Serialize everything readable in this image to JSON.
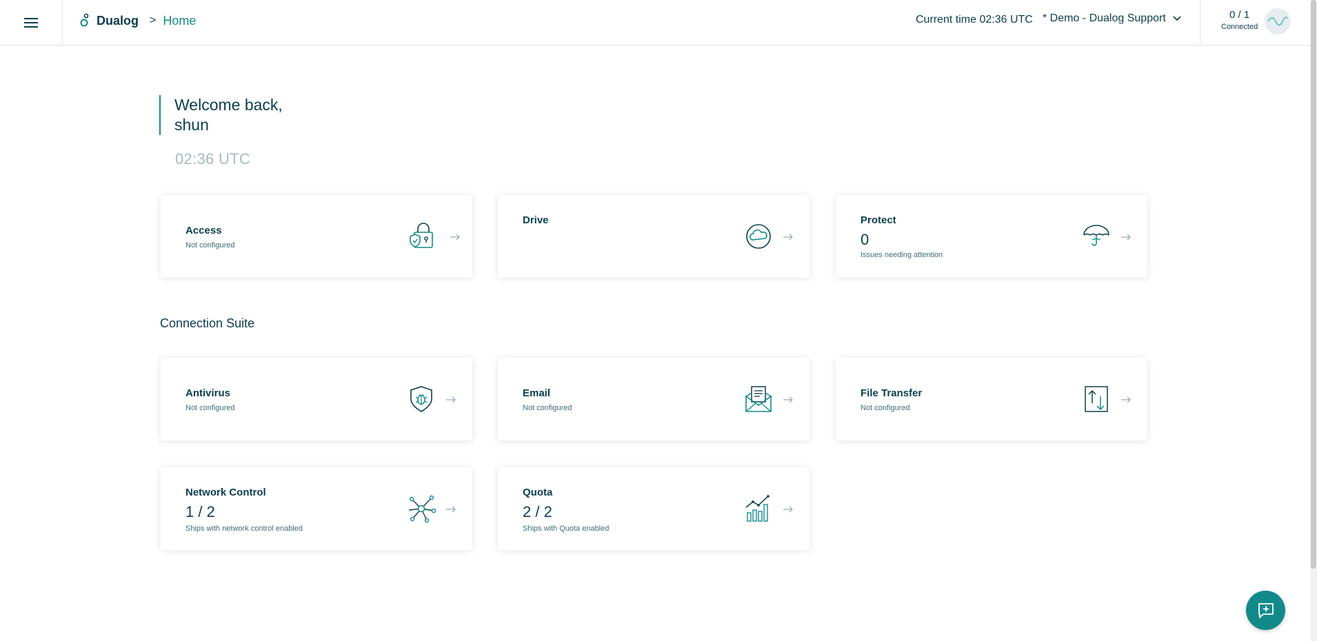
{
  "header": {
    "brand": "Dualog",
    "breadcrumb_sep": ">",
    "breadcrumb_current": "Home",
    "current_time": "Current time 02:36 UTC",
    "org_selected": "* Demo - Dualog Support",
    "connection_count": "0 / 1",
    "connection_label": "Connected"
  },
  "welcome": {
    "line1": "Welcome back,",
    "line2": "shun",
    "time": "02:36 UTC"
  },
  "top_cards": {
    "access": {
      "title": "Access",
      "sub": "Not configured",
      "icon": "lock-shield-icon"
    },
    "drive": {
      "title": "Drive",
      "icon": "cloud-icon"
    },
    "protect": {
      "title": "Protect",
      "value": "0",
      "sub": "Issues needing attention",
      "icon": "umbrella-icon"
    }
  },
  "section_title": "Connection Suite",
  "suite_cards": {
    "antivirus": {
      "title": "Antivirus",
      "sub": "Not configured",
      "icon": "bug-shield-icon"
    },
    "email": {
      "title": "Email",
      "sub": "Not configured",
      "icon": "envelope-icon"
    },
    "file_transfer": {
      "title": "File Transfer",
      "sub": "Not configured",
      "icon": "transfer-icon"
    },
    "network_control": {
      "title": "Network Control",
      "value": "1 / 2",
      "sub": "Ships with network control enabled",
      "icon": "network-nodes-icon"
    },
    "quota": {
      "title": "Quota",
      "value": "2 / 2",
      "sub": "Ships with Quota enabled",
      "icon": "bar-chart-icon"
    }
  },
  "colors": {
    "accent": "#138a8a",
    "text": "#0b3d4f",
    "muted_time": "#a6bac2"
  }
}
